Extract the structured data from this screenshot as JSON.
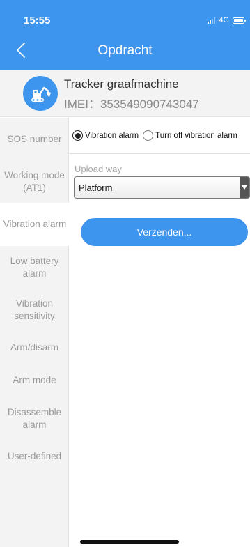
{
  "status_bar": {
    "time": "15:55",
    "network": "4G"
  },
  "header": {
    "title": "Opdracht",
    "back_icon": "chevron-left-icon"
  },
  "device": {
    "icon": "excavator-icon",
    "name": "Tracker graafmachine",
    "imei": "IMEI：353549090743047"
  },
  "sidebar": {
    "items": [
      {
        "label": "SOS number",
        "active": false
      },
      {
        "label": "Working mode (AT1)",
        "active": false
      },
      {
        "label": "Vibration alarm",
        "active": true
      },
      {
        "label": "Low battery alarm",
        "active": false
      },
      {
        "label": "Vibration sensitivity",
        "active": false
      },
      {
        "label": "Arm/disarm",
        "active": false
      },
      {
        "label": "Arm mode",
        "active": false
      },
      {
        "label": "Disassemble alarm",
        "active": false
      },
      {
        "label": "User-defined",
        "active": false
      }
    ]
  },
  "form": {
    "radio_options": [
      {
        "label": "Vibration alarm",
        "checked": true
      },
      {
        "label": "Turn off vibration alarm",
        "checked": false
      }
    ],
    "upload_label": "Upload way",
    "upload_value": "Platform",
    "send_label": "Verzenden..."
  },
  "colors": {
    "accent": "#3e95ee",
    "sidebar_bg": "#f3f3f3"
  }
}
